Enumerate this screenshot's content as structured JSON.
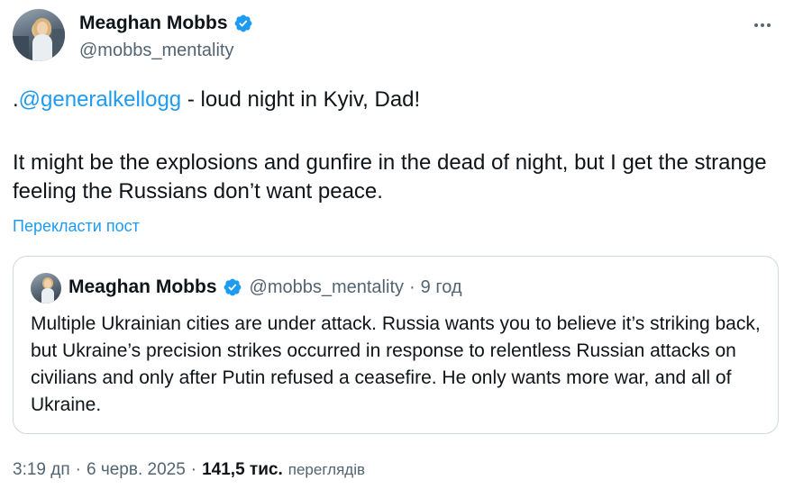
{
  "author": {
    "name": "Meaghan Mobbs",
    "handle": "@mobbs_mentality"
  },
  "post": {
    "prefix": ".",
    "mention": "@generalkellogg",
    "line1_rest": " - loud night in Kyiv, Dad!",
    "paragraph2": "It might be the explosions and gunfire in the dead of night, but I get the strange feeling the Russians don’t want peace.",
    "translate_label": "Перекласти пост"
  },
  "quote": {
    "name": "Meaghan Mobbs",
    "handle": "@mobbs_mentality",
    "separator": "·",
    "time": "9 год",
    "text": "Multiple Ukrainian cities are under attack. Russia wants you to believe it’s striking back, but Ukraine’s precision strikes occurred in response to relentless Russian attacks on civilians and only after Putin refused a ceasefire. He only wants more war, and all of Ukraine."
  },
  "meta": {
    "time": "3:19 дп",
    "separator": "·",
    "date": "6 черв. 2025",
    "views": "141,5 тис.",
    "views_label": "переглядів"
  },
  "colors": {
    "accent": "#1d9bf0",
    "text": "#0f1419",
    "secondary": "#536471",
    "border": "#cfd9de"
  },
  "icons": {
    "verified": "verified-badge-icon",
    "more": "more-options-icon"
  }
}
